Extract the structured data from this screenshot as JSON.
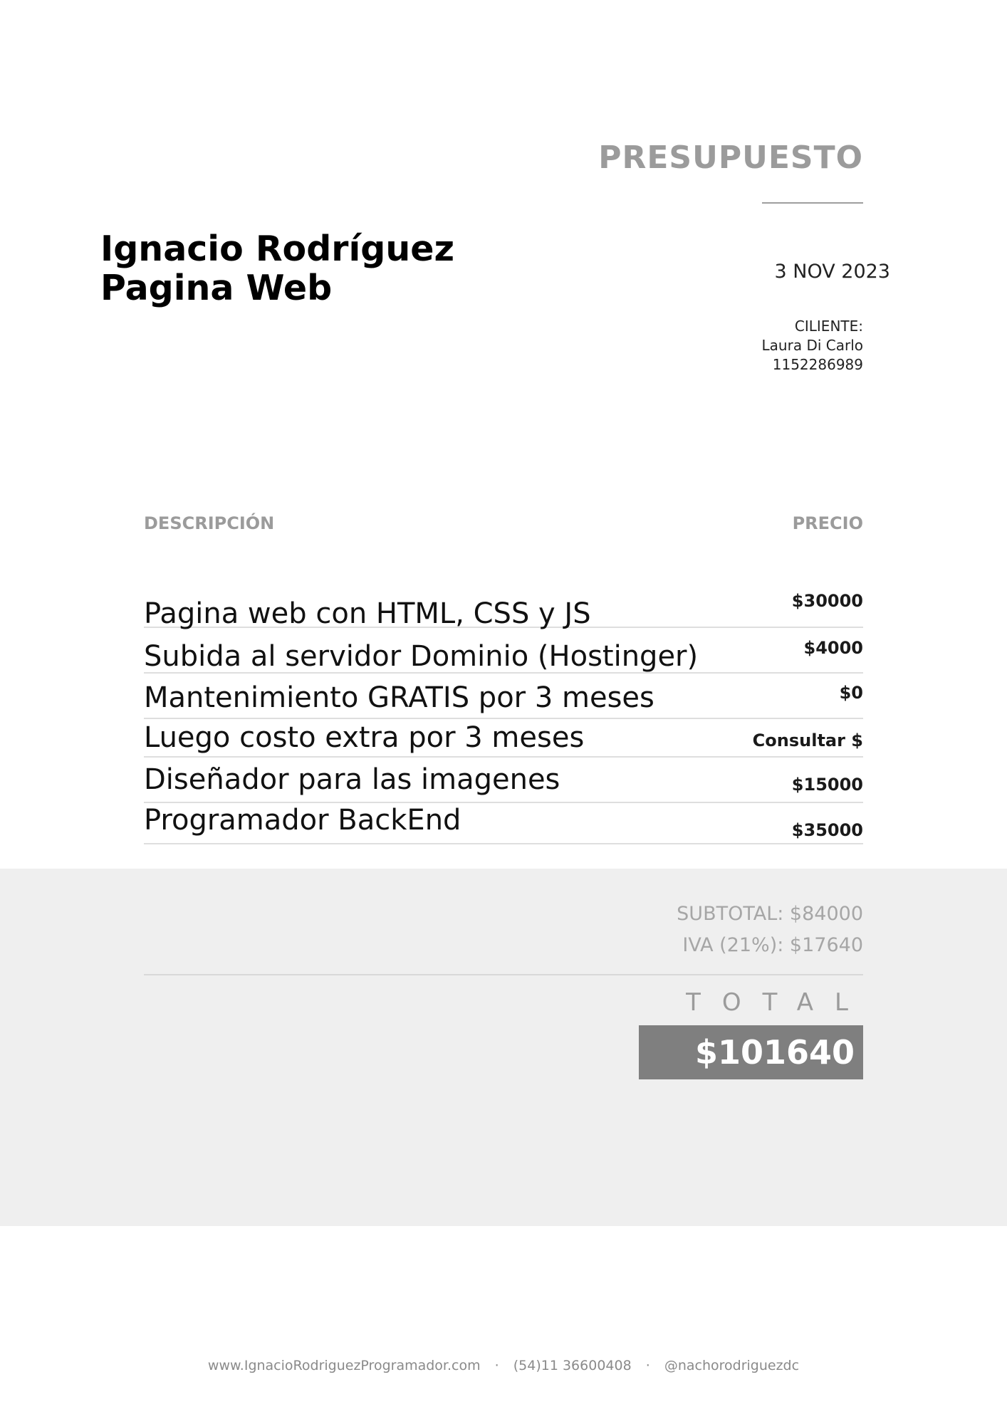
{
  "document": {
    "title": "PRESUPUESTO",
    "issuer_name": "Ignacio Rodríguez",
    "issuer_subtitle": "Pagina Web",
    "date": "3 NOV 2023"
  },
  "client": {
    "label": "CILIENTE:",
    "name": "Laura Di Carlo",
    "phone": "1152286989"
  },
  "table": {
    "col_description": "DESCRIPCIÓN",
    "col_price": "PRECIO",
    "items": [
      {
        "description": "Pagina web con HTML, CSS y JS",
        "price": "$30000"
      },
      {
        "description": "Subida al servidor Dominio (Hostinger)",
        "price": "$4000"
      },
      {
        "description": "Mantenimiento GRATIS por 3 meses",
        "price": "$0"
      },
      {
        "description": "Luego costo extra por 3 meses",
        "price": "Consultar $"
      },
      {
        "description": "Diseñador para las imagenes",
        "price": "$15000"
      },
      {
        "description": "Programador BackEnd",
        "price": "$35000"
      }
    ]
  },
  "totals": {
    "subtotal": "SUBTOTAL: $84000",
    "tax": "IVA (21%): $17640",
    "total_label": "TOTAL",
    "total_value": "$101640"
  },
  "footer": {
    "website": "www.IgnacioRodriguezProgramador.com",
    "separator": "·",
    "phone": "(54)11 36600408",
    "handle": "@nachorodriguezdc"
  },
  "colors": {
    "muted_gray": "#9b9b9b",
    "panel_bg": "#efefef",
    "total_box": "#7f7f7f"
  }
}
